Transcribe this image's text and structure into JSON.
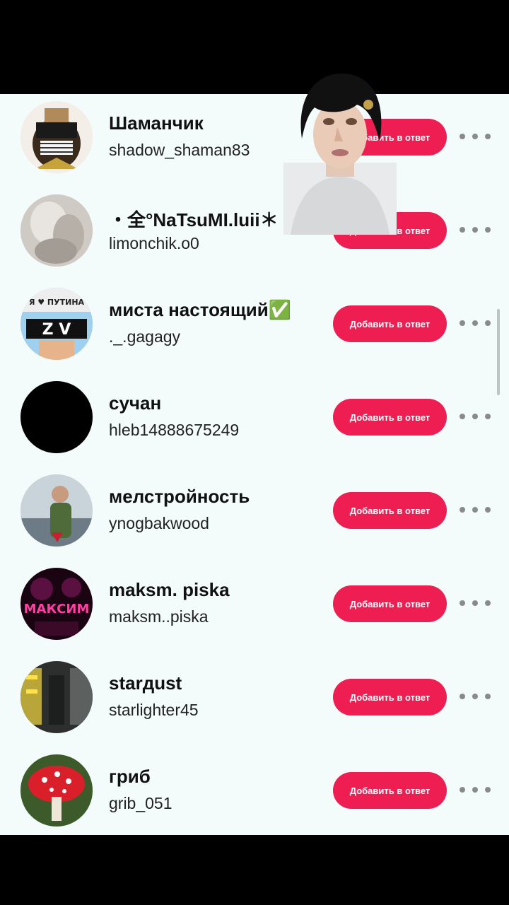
{
  "users": [
    {
      "display_name": "Шаманчик",
      "username": "shadow_shaman83",
      "button_label": "Добавить в ответ"
    },
    {
      "display_name": "・全°NaTsuMI.luii＊",
      "username": "limonchik.o0",
      "button_label": "Добавить в ответ"
    },
    {
      "display_name": "миста настоящий✅",
      "username": "._.gagagy",
      "button_label": "Добавить в ответ"
    },
    {
      "display_name": "сучан",
      "username": "hleb14888675249",
      "button_label": "Добавить в ответ"
    },
    {
      "display_name": "мелстройность",
      "username": "ynogbakwood",
      "button_label": "Добавить в ответ"
    },
    {
      "display_name": "maksm. piska",
      "username": "maksm..piska",
      "button_label": "Добавить в ответ"
    },
    {
      "display_name": "starдust",
      "username": "starlighter45",
      "button_label": "Добавить в ответ"
    },
    {
      "display_name": "гриб",
      "username": "grib_051",
      "button_label": "Добавить в ответ"
    }
  ],
  "avatar_texts": {
    "zv_top": "Я ♥ ПУТИНА",
    "zv_letters": "Z V",
    "maksim": "МАКСИМ"
  },
  "colors": {
    "accent": "#ee1d52",
    "panel_bg": "#f4fbfb",
    "more_dots": "#8a8a8a"
  },
  "icons": {
    "more": "horizontal-ellipsis"
  }
}
